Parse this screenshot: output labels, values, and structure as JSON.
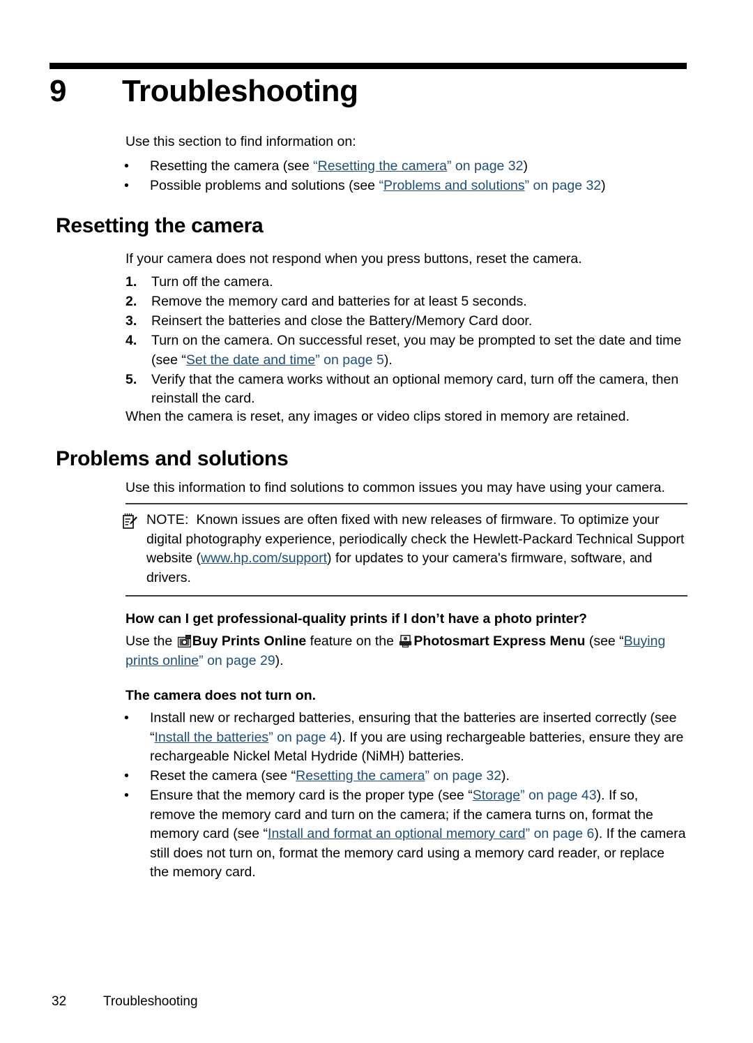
{
  "document": {
    "top_rule": true,
    "chapter": {
      "number": "9",
      "title": "Troubleshooting"
    },
    "intro": "Use this section to find information on:",
    "intro_bullets": [
      {
        "pre": "Resetting the camera (see ",
        "quote_open": "“",
        "link": "Resetting the camera",
        "quote_close": "”",
        "link_tail": " on page 32",
        "post": ")"
      },
      {
        "pre": "Possible problems and solutions (see ",
        "quote_open": "“",
        "link": "Problems and solutions",
        "quote_close": "”",
        "link_tail": " on page 32",
        "post": ")"
      }
    ],
    "section_reset": {
      "heading": "Resetting the camera",
      "lead": "If your camera does not respond when you press buttons, reset the camera.",
      "steps": [
        {
          "marker": "1.",
          "text": "Turn off the camera."
        },
        {
          "marker": "2.",
          "text": "Remove the memory card and batteries for at least 5 seconds."
        },
        {
          "marker": "3.",
          "text": "Reinsert the batteries and close the Battery/Memory Card door."
        },
        {
          "marker": "4.",
          "pre": "Turn on the camera. On successful reset, you may be prompted to set the date and time (see “",
          "link": "Set the date and time",
          "link_tail": "” on page 5",
          "post": ")."
        },
        {
          "marker": "5.",
          "text": "Verify that the camera works without an optional memory card, turn off the camera, then reinstall the card."
        }
      ],
      "closing": "When the camera is reset, any images or video clips stored in memory are retained."
    },
    "section_problems": {
      "heading": "Problems and solutions",
      "lead": "Use this information to find solutions to common issues you may have using your camera.",
      "note": {
        "icon": "note-pencil-icon",
        "label": "NOTE:",
        "pre": "Known issues are often fixed with new releases of firmware. To optimize your digital photography experience, periodically check the Hewlett-Packard Technical Support website (",
        "link": "www.hp.com/support",
        "post": ") for updates to your camera's firmware, software, and drivers."
      },
      "question_1": {
        "heading": "How can I get professional-quality prints if I don’t have a photo printer?",
        "answer_pre": "Use the ",
        "icon_1": "buy-prints-online-icon",
        "bold_1": "Buy Prints Online",
        "mid": " feature on the ",
        "icon_2": "photosmart-express-icon",
        "bold_2": "Photosmart Express Menu",
        "answer_mid2": " (see “",
        "link": "Buying prints online",
        "link_tail": "” on page 29",
        "answer_post": ")."
      },
      "question_2": {
        "heading": "The camera does not turn on.",
        "bullets": [
          {
            "pre": "Install new or recharged batteries, ensuring that the batteries are inserted correctly (see “",
            "link": "Install the batteries",
            "link_tail": "” on page 4",
            "post": "). If you are using rechargeable batteries, ensure they are rechargeable Nickel Metal Hydride (NiMH) batteries."
          },
          {
            "pre": "Reset the camera (see “",
            "link": "Resetting the camera",
            "link_tail": "” on page 32",
            "post": ")."
          },
          {
            "pre": "Ensure that the memory card is the proper type (see “",
            "link": "Storage",
            "link_tail": "” on page 43",
            "mid": "). If so, remove the memory card and turn on the camera; if the camera turns on, format the memory card (see “",
            "link2": "Install and format an optional memory card",
            "link2_tail": "” on page 6",
            "post": "). If the camera still does not turn on, format the memory card using a memory card reader, or replace the memory card."
          }
        ]
      }
    },
    "footer": {
      "page_number": "32",
      "chapter_name": "Troubleshooting"
    },
    "colors": {
      "link": "#1F4E79",
      "rule": "#000000",
      "note_rule": "#3a3a3a"
    }
  }
}
